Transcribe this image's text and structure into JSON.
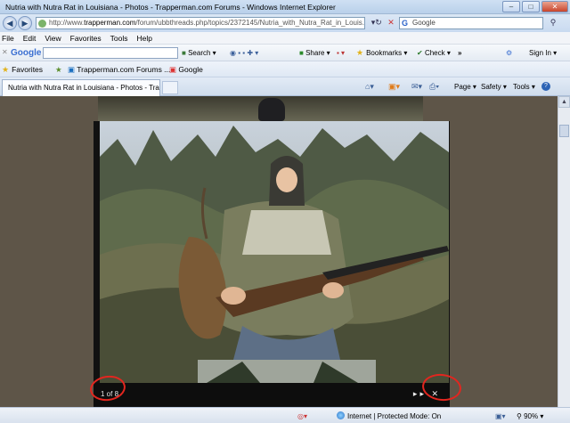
{
  "window": {
    "title": "Nutria with Nutra Rat in Louisiana - Photos - Trapperman.com Forums - Windows Internet Explorer",
    "min": "–",
    "max": "□",
    "close": "✕"
  },
  "address": {
    "url_prefix": "http://www.",
    "url_domain": "trapperman.com",
    "url_rest": "/forum/ubbthreads.php/topics/2372145/Nutria_with_Nutra_Rat_in_Louis...",
    "search_placeholder": "Google",
    "back": "◀",
    "forward": "▶",
    "dropdown": "▾",
    "refresh": "↻",
    "stop": "✕"
  },
  "menu": [
    "File",
    "Edit",
    "View",
    "Favorites",
    "Tools",
    "Help"
  ],
  "google_toolbar": {
    "logo": "Google",
    "search": "Search ▾",
    "share": "Share ▾",
    "bookmarks": "Bookmarks ▾",
    "check": "Check ▾",
    "more": "»",
    "signin": "Sign In ▾"
  },
  "favorites_bar": {
    "favorites": "Favorites",
    "link1": "Trapperman.com Forums ...",
    "link2": "Google"
  },
  "tab": {
    "title": "Nutria with Nutra Rat in Louisiana - Photos - Tra..."
  },
  "command_bar": {
    "page": "Page ▾",
    "safety": "Safety ▾",
    "tools": "Tools ▾",
    "help": "?"
  },
  "lightbox": {
    "counter": "1 of 8",
    "controls": "▸▸ ✕"
  },
  "status": {
    "zone": "Internet | Protected Mode: On",
    "zoom": "90%"
  }
}
